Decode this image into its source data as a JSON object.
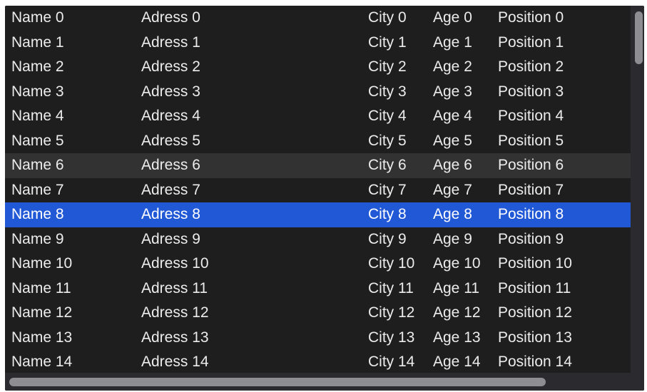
{
  "table": {
    "selected_row": 8,
    "hovered_row": 6,
    "rows": [
      {
        "name": "Name 0",
        "address": "Adress 0",
        "city": "City 0",
        "age": "Age 0",
        "position": "Position 0"
      },
      {
        "name": "Name 1",
        "address": "Adress 1",
        "city": "City 1",
        "age": "Age 1",
        "position": "Position 1"
      },
      {
        "name": "Name 2",
        "address": "Adress 2",
        "city": "City 2",
        "age": "Age 2",
        "position": "Position 2"
      },
      {
        "name": "Name 3",
        "address": "Adress 3",
        "city": "City 3",
        "age": "Age 3",
        "position": "Position 3"
      },
      {
        "name": "Name 4",
        "address": "Adress 4",
        "city": "City 4",
        "age": "Age 4",
        "position": "Position 4"
      },
      {
        "name": "Name 5",
        "address": "Adress 5",
        "city": "City 5",
        "age": "Age 5",
        "position": "Position 5"
      },
      {
        "name": "Name 6",
        "address": "Adress 6",
        "city": "City 6",
        "age": "Age 6",
        "position": "Position 6"
      },
      {
        "name": "Name 7",
        "address": "Adress 7",
        "city": "City 7",
        "age": "Age 7",
        "position": "Position 7"
      },
      {
        "name": "Name 8",
        "address": "Adress 8",
        "city": "City 8",
        "age": "Age 8",
        "position": "Position 8"
      },
      {
        "name": "Name 9",
        "address": "Adress 9",
        "city": "City 9",
        "age": "Age 9",
        "position": "Position 9"
      },
      {
        "name": "Name 10",
        "address": "Adress 10",
        "city": "City 10",
        "age": "Age 10",
        "position": "Position 10"
      },
      {
        "name": "Name 11",
        "address": "Adress 11",
        "city": "City 11",
        "age": "Age 11",
        "position": "Position 11"
      },
      {
        "name": "Name 12",
        "address": "Adress 12",
        "city": "City 12",
        "age": "Age 12",
        "position": "Position 12"
      },
      {
        "name": "Name 13",
        "address": "Adress 13",
        "city": "City 13",
        "age": "Age 13",
        "position": "Position 13"
      },
      {
        "name": "Name 14",
        "address": "Adress 14",
        "city": "City 14",
        "age": "Age 14",
        "position": "Position 14"
      }
    ]
  },
  "colors": {
    "background": "#1e1e1e",
    "selection": "#2158d6",
    "hover": "#323232",
    "text": "#ececec",
    "scroll_thumb": "#8e8d92"
  }
}
